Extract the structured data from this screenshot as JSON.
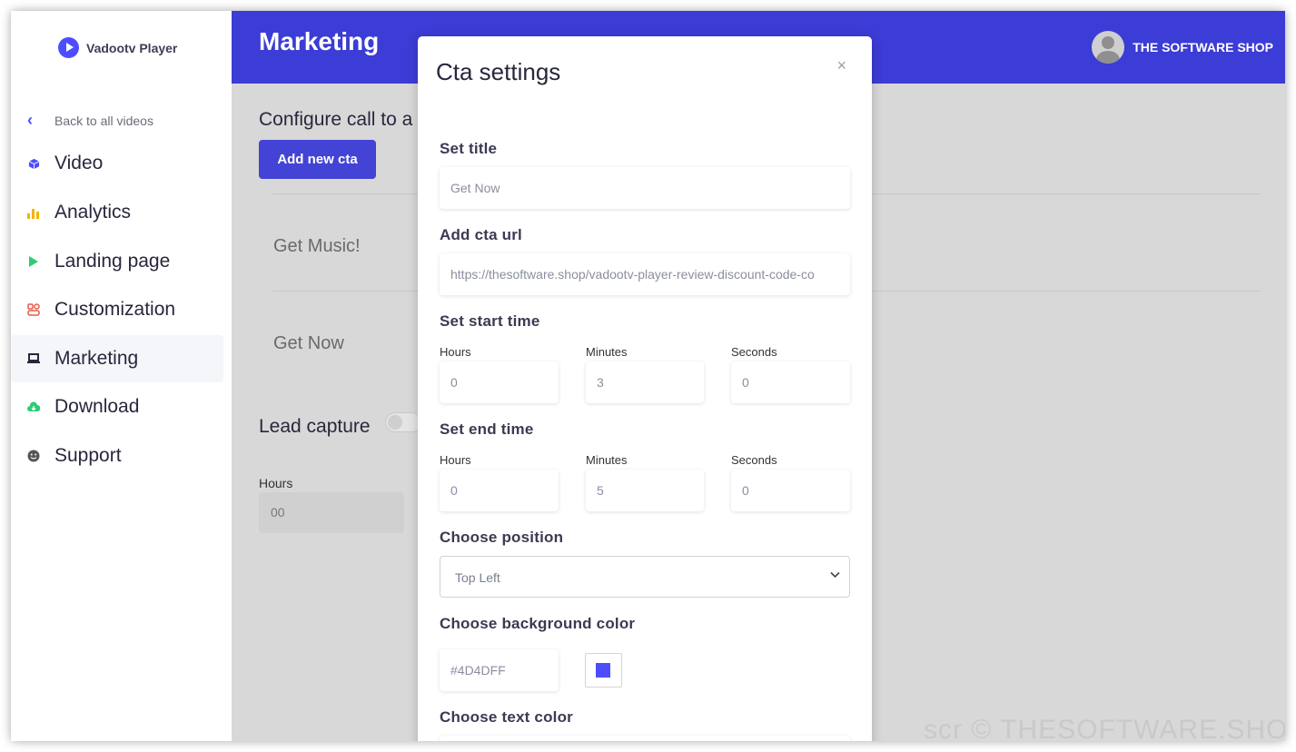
{
  "app": {
    "name": "Vadootv Player",
    "brand_color": "#3c3cd6",
    "back_label": "Back to all videos"
  },
  "sidebar": {
    "items": [
      {
        "label": "Video",
        "icon": "cube-icon",
        "color": "#4d4dff"
      },
      {
        "label": "Analytics",
        "icon": "bar-chart-icon",
        "color": "#f2b400"
      },
      {
        "label": "Landing page",
        "icon": "play-icon",
        "color": "#2ecc71"
      },
      {
        "label": "Customization",
        "icon": "palette-icon",
        "color": "#e8584a"
      },
      {
        "label": "Marketing",
        "icon": "laptop-icon",
        "color": "#27273d",
        "active": true
      },
      {
        "label": "Download",
        "icon": "cloud-download-icon",
        "color": "#2ecc71"
      },
      {
        "label": "Support",
        "icon": "smiley-icon",
        "color": "#555555"
      }
    ]
  },
  "header": {
    "title": "Marketing",
    "user_name": "THE SOFTWARE SHOP"
  },
  "content": {
    "configure_heading": "Configure call to a",
    "add_button": "Add new cta",
    "cta_items": [
      "Get Music!",
      "Get Now"
    ],
    "lead_capture": "Lead capture",
    "toggle_label": "O",
    "hours_label": "Hours",
    "hours_value": "00"
  },
  "modal": {
    "title": "Cta settings",
    "close": "×",
    "set_title_label": "Set title",
    "set_title_value": "Get Now",
    "url_label": "Add cta url",
    "url_value": "https://thesoftware.shop/vadootv-player-review-discount-code-co",
    "start_label": "Set start time",
    "start": {
      "hours_label": "Hours",
      "hours": "0",
      "minutes_label": "Minutes",
      "minutes": "3",
      "seconds_label": "Seconds",
      "seconds": "0"
    },
    "end_label": "Set end time",
    "end": {
      "hours_label": "Hours",
      "hours": "0",
      "minutes_label": "Minutes",
      "minutes": "5",
      "seconds_label": "Seconds",
      "seconds": "0"
    },
    "position_label": "Choose position",
    "position_value": "Top Left",
    "bg_color_label": "Choose background color",
    "bg_color_value": "#4D4DFF",
    "text_color_label": "Choose text color"
  },
  "watermark": "scr © THESOFTWARE.SHOP"
}
